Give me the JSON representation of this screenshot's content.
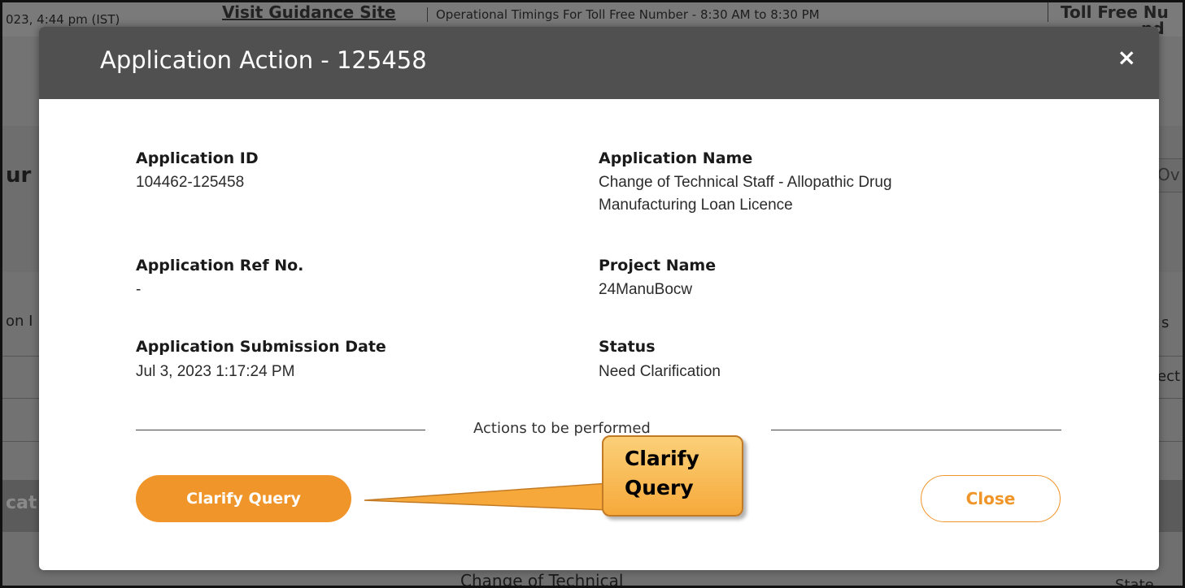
{
  "background": {
    "top_left_text": "023, 4:44 pm (IST)",
    "guidance_link": "Visit Guidance Site",
    "timings_text": "Operational Timings For Toll Free Number - 8:30 AM to 8:30 PM",
    "tollfree_text": "Toll Free Nu",
    "email_text": "pd",
    "side_left_1": "ur",
    "side_left_2": "on I",
    "side_left_3": "cat",
    "side_right_1": "Ov",
    "side_right_2": "s",
    "side_right_3": "ect",
    "bottom_text": "Change of Technical",
    "bottom_right": "State"
  },
  "modal": {
    "title": "Application Action - 125458",
    "close_icon": "×",
    "fields": {
      "app_id_label": "Application ID",
      "app_id_value": "104462-125458",
      "app_name_label": "Application Name",
      "app_name_value_line1": "Change of Technical Staff - Allopathic Drug",
      "app_name_value_line2": "Manufacturing Loan Licence",
      "ref_label": "Application Ref No.",
      "ref_value": "-",
      "project_label": "Project Name",
      "project_value": "24ManuBocw",
      "date_label": "Application Submission Date",
      "date_value": "Jul 3, 2023 1:17:24 PM",
      "status_label": "Status",
      "status_value": "Need Clarification"
    },
    "actions_label": "Actions to be performed",
    "clarify_button": "Clarify Query",
    "close_button": "Close"
  },
  "callout": {
    "line1": "Clarify",
    "line2": "Query"
  },
  "colors": {
    "accent": "#f0952a",
    "header": "#505050"
  }
}
